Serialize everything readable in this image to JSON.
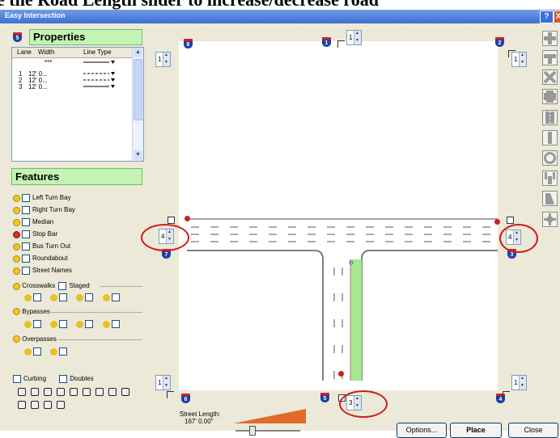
{
  "caption": "e the Road Length slider to  increase/decrease road",
  "window": {
    "title": "Easy Intersection",
    "help_glyph": "?",
    "close_glyph": "X"
  },
  "properties": {
    "header": "Properties",
    "shield_label": "5",
    "columns": [
      "Lane",
      "Width",
      "Line Type"
    ],
    "rows": [
      {
        "lane": "",
        "width": "***",
        "line": "solid"
      },
      {
        "lane": "1",
        "width": "12' 0...",
        "line": "dashed"
      },
      {
        "lane": "2",
        "width": "12' 0...",
        "line": "dashed"
      },
      {
        "lane": "3",
        "width": "12' 0...",
        "line": "solid"
      }
    ],
    "scroll_up": "▲",
    "scroll_down": "▼"
  },
  "features": {
    "header": "Features",
    "items": [
      "Left Turn Bay",
      "Right Turn Bay",
      "Median",
      "Stop Bar",
      "Bus Turn Out",
      "Roundabout",
      "Street Names"
    ],
    "crosswalks_label": "Crosswalks",
    "staged_label": "Staged",
    "bypasses_label": "Bypasses",
    "overpasses_label": "Overpasses",
    "curbing_label": "Curbing",
    "doubles_label": "Doubles"
  },
  "canvas": {
    "route_shields": [
      "8",
      "1",
      "2",
      "7",
      "3",
      "6",
      "5",
      "4"
    ],
    "spinners": {
      "top_left": "1",
      "top_center": "1",
      "top_right": "1",
      "left": "4",
      "right": "4",
      "bottom_left": "1",
      "bottom_center": "3",
      "bottom_right": "1"
    }
  },
  "street_length": {
    "label": "Street Length:",
    "value": "167' 0.00\""
  },
  "buttons": {
    "options": "Options...",
    "place": "Place",
    "close": "Close"
  },
  "colors": {
    "median_green": "#a8e88c",
    "stop_red": "#cc2020",
    "annotation_red": "#d01818",
    "header_green": "#c4f4b4"
  }
}
